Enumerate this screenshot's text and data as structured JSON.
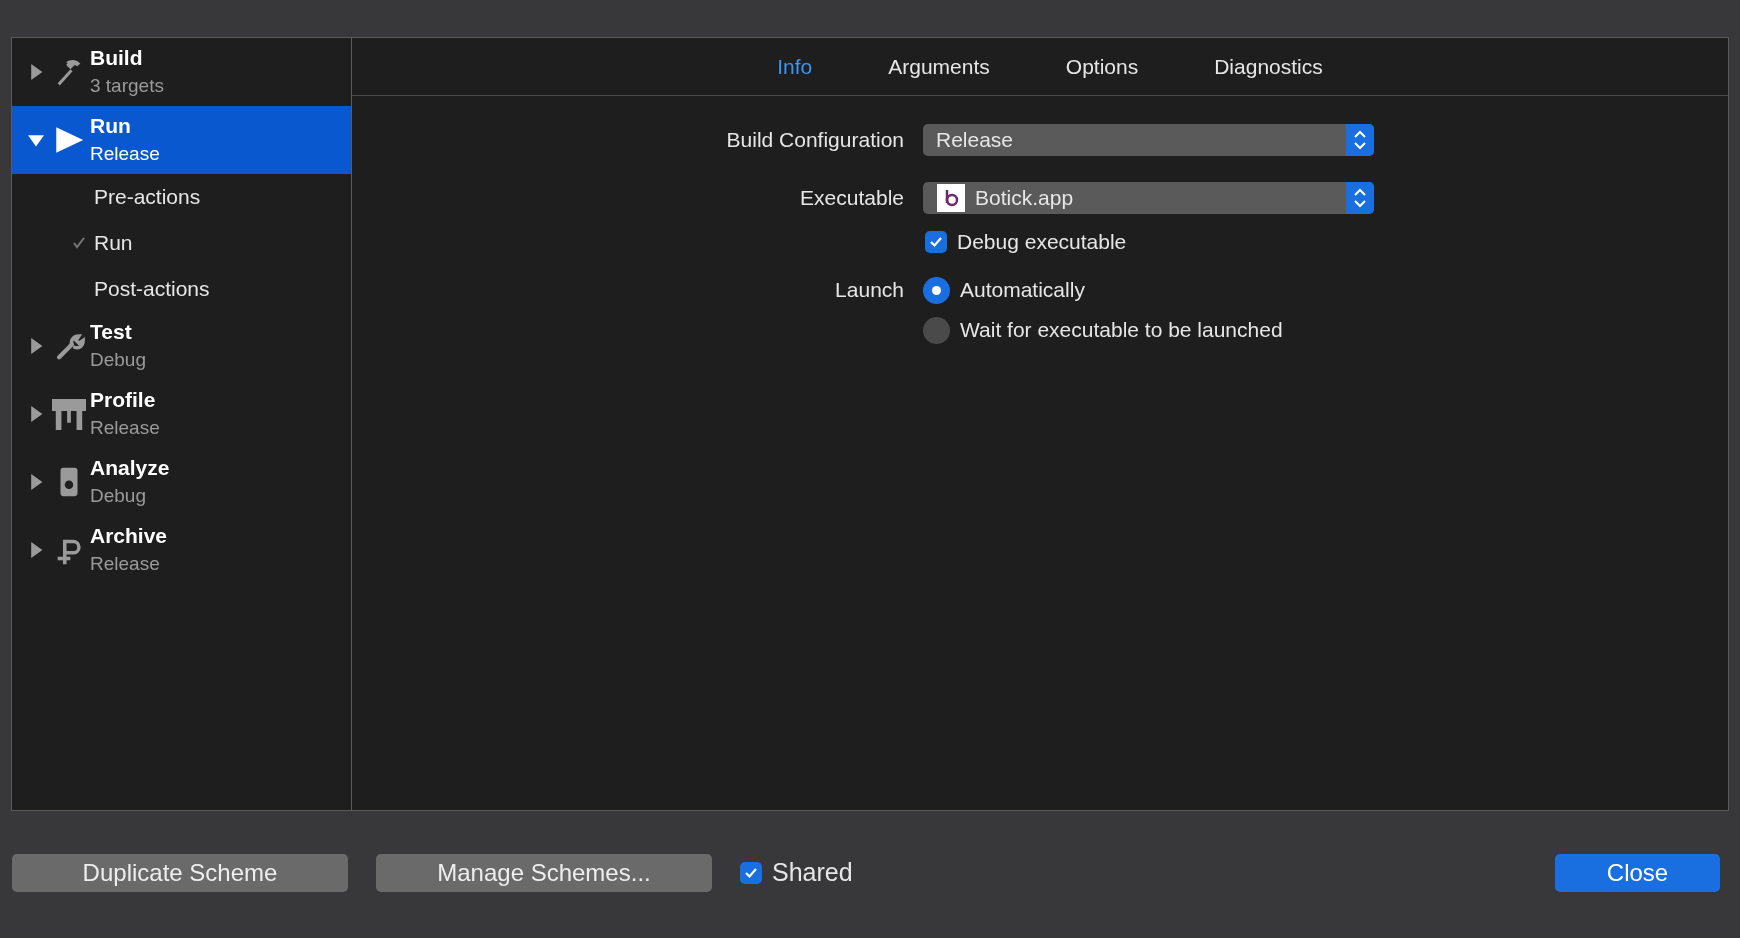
{
  "sidebar": {
    "items": [
      {
        "title": "Build",
        "subtitle": "3 targets",
        "selected": false,
        "expanded": false
      },
      {
        "title": "Run",
        "subtitle": "Release",
        "selected": true,
        "expanded": true,
        "children": [
          {
            "label": "Pre-actions",
            "checked": false
          },
          {
            "label": "Run",
            "checked": true
          },
          {
            "label": "Post-actions",
            "checked": false
          }
        ]
      },
      {
        "title": "Test",
        "subtitle": "Debug",
        "selected": false,
        "expanded": false
      },
      {
        "title": "Profile",
        "subtitle": "Release",
        "selected": false,
        "expanded": false
      },
      {
        "title": "Analyze",
        "subtitle": "Debug",
        "selected": false,
        "expanded": false
      },
      {
        "title": "Archive",
        "subtitle": "Release",
        "selected": false,
        "expanded": false
      }
    ]
  },
  "tabs": [
    {
      "label": "Info",
      "selected": true
    },
    {
      "label": "Arguments",
      "selected": false
    },
    {
      "label": "Options",
      "selected": false
    },
    {
      "label": "Diagnostics",
      "selected": false
    }
  ],
  "form": {
    "build_configuration": {
      "label": "Build Configuration",
      "value": "Release"
    },
    "executable": {
      "label": "Executable",
      "value": "Botick.app"
    },
    "debug_executable": {
      "label": "Debug executable",
      "checked": true
    },
    "launch": {
      "label": "Launch",
      "options": [
        {
          "label": "Automatically",
          "selected": true
        },
        {
          "label": "Wait for executable to be launched",
          "selected": false
        }
      ]
    }
  },
  "footer": {
    "buttons": [
      "Duplicate Scheme",
      "Manage Schemes..."
    ],
    "shared": {
      "label": "Shared",
      "checked": true
    },
    "close": "Close"
  }
}
